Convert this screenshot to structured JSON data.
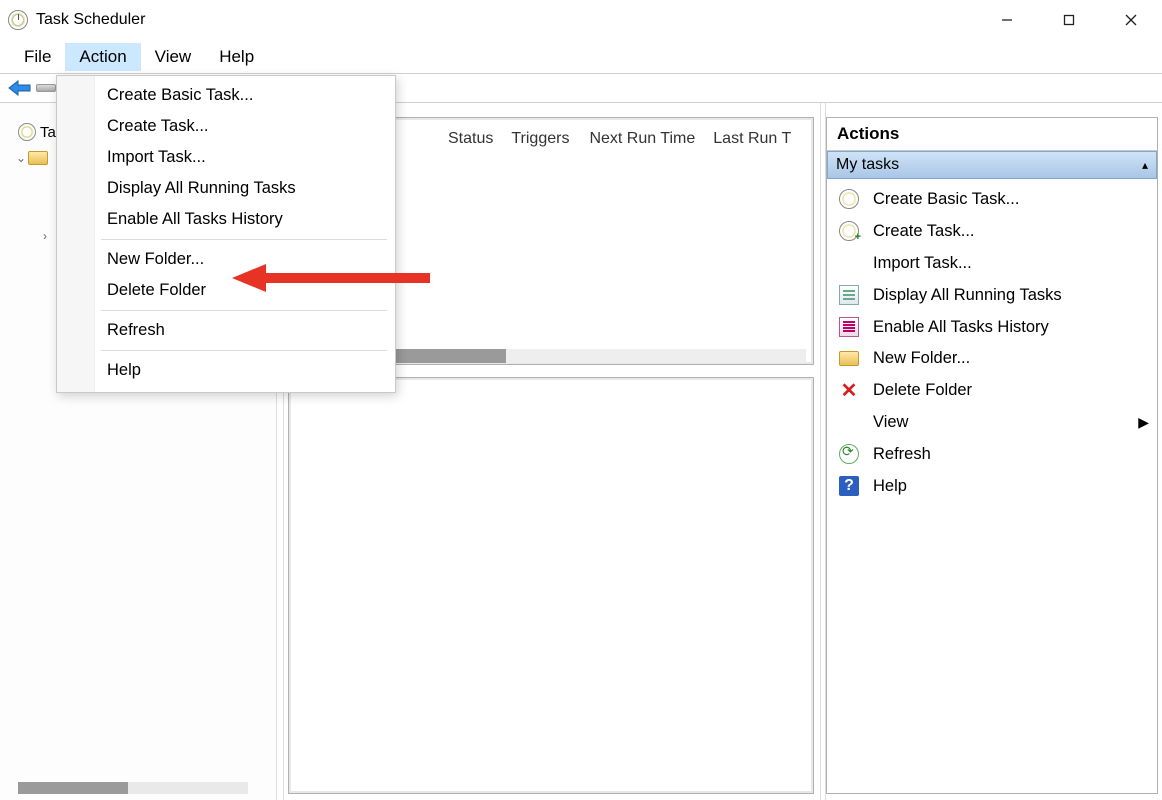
{
  "titlebar": {
    "title": "Task Scheduler"
  },
  "menubar": {
    "file": "File",
    "action": "Action",
    "view": "View",
    "help": "Help"
  },
  "tree": {
    "root_label": "Ta",
    "child_visible_prefix": ""
  },
  "columns": {
    "status": "Status",
    "triggers": "Triggers",
    "next_run": "Next Run Time",
    "last_run": "Last Run T"
  },
  "actions_pane": {
    "title": "Actions",
    "section": "My tasks",
    "items": {
      "create_basic": "Create Basic Task...",
      "create_task": "Create Task...",
      "import_task": "Import Task...",
      "display_running": "Display All Running Tasks",
      "enable_history": "Enable All Tasks History",
      "new_folder": "New Folder...",
      "delete_folder": "Delete Folder",
      "view": "View",
      "refresh": "Refresh",
      "help": "Help"
    }
  },
  "dropdown": {
    "create_basic": "Create Basic Task...",
    "create_task": "Create Task...",
    "import_task": "Import Task...",
    "display_running": "Display All Running Tasks",
    "enable_history": "Enable All Tasks History",
    "new_folder": "New Folder...",
    "delete_folder": "Delete Folder",
    "refresh": "Refresh",
    "help": "Help"
  }
}
